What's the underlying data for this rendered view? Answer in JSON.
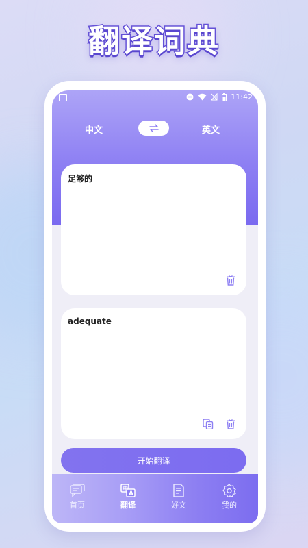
{
  "promo": {
    "title": "翻译词典"
  },
  "status_bar": {
    "time": "11:42"
  },
  "languages": {
    "source": "中文",
    "target": "英文",
    "swap_icon": "swap-arrows-icon"
  },
  "input_card": {
    "text": "足够的",
    "delete_icon": "trash-icon"
  },
  "output_card": {
    "text": "adequate",
    "copy_icon": "copy-icon",
    "delete_icon": "trash-icon"
  },
  "actions": {
    "translate_label": "开始翻译"
  },
  "nav": {
    "items": [
      {
        "label": "首页",
        "icon": "chat-bubbles-icon"
      },
      {
        "label": "翻译",
        "icon": "translate-icon",
        "active": true
      },
      {
        "label": "好文",
        "icon": "document-icon"
      },
      {
        "label": "我的",
        "icon": "gear-icon"
      }
    ]
  },
  "colors": {
    "accent": "#7c6cf0",
    "accent_light": "#ada4f7",
    "icon_purple": "#8d7ff3"
  }
}
